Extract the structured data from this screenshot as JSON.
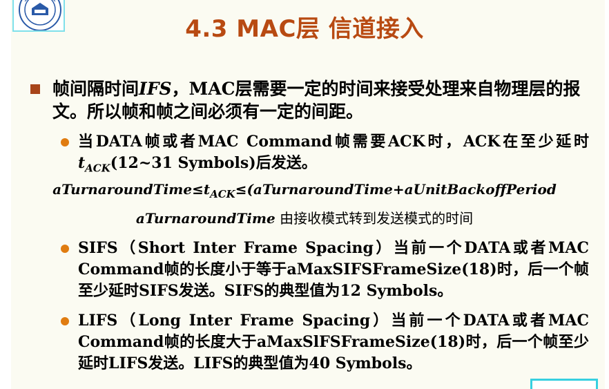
{
  "header": {
    "title": "4.3  MAC层  信道接入"
  },
  "main": {
    "point1": {
      "pre": "帧间隔时间",
      "ifs": "IFS",
      "post": "，MAC层需要一定的时间来接受处理来自物理层的报文。所以帧和帧之间必须有一定的间距。"
    },
    "ack": {
      "text_a": "当DATA帧或者MAC  Command帧需要ACK时，ACK在至少延时",
      "t_symbol": "t",
      "t_sub": "ACK",
      "text_b": "(12~31 Symbols)后发送。"
    },
    "formula1": {
      "left": "aTurnaroundTime≤",
      "t_symbol": "t",
      "t_sub": "ACK",
      "right": "≤(aTurnaroundTime+aUnitBackoffPeriod"
    },
    "formula2": {
      "term": "aTurnaroundTime",
      "desc": " 由接收模式转到发送模式的时间"
    },
    "sifs": {
      "text": "SIFS（Short  Inter  Frame  Spacing）当前一个DATA或者MAC Command帧的长度小于等于aMaxSIFSFrameSize(18)时，后一个帧至少延时SIFS发送。SIFS的典型值为12 Symbols。"
    },
    "lifs": {
      "text": "LIFS（Long  Inter  Frame  Spacing）当前一个DATA或者MAC Command帧的长度大于aMaxSlFSFrameSize(18)时，后一个帧至少延时LIFS发送。LIFS的典型值为40 Symbols。"
    }
  },
  "colors": {
    "title": "#b84a12",
    "bullet_square": "#a8451a",
    "bullet_dot": "#e07c10",
    "frame_accent": "#37d0e0"
  },
  "icons": {
    "logo": "university-seal-icon",
    "corner": "media-button-icon"
  }
}
